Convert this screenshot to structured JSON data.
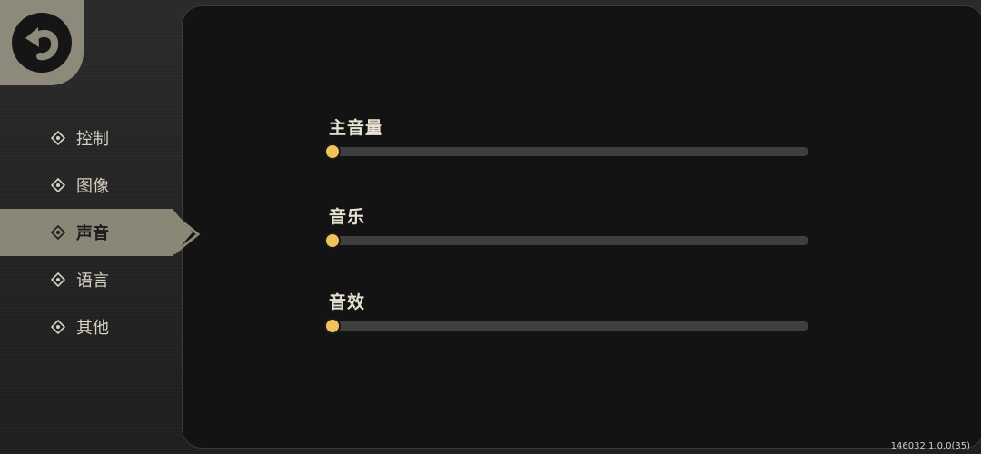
{
  "sidebar": {
    "items": [
      {
        "label": "控制",
        "active": false
      },
      {
        "label": "图像",
        "active": false
      },
      {
        "label": "声音",
        "active": true
      },
      {
        "label": "语言",
        "active": false
      },
      {
        "label": "其他",
        "active": false
      }
    ]
  },
  "settings": [
    {
      "label": "主音量",
      "value": 0
    },
    {
      "label": "音乐",
      "value": 0
    },
    {
      "label": "音效",
      "value": 0
    }
  ],
  "footer": {
    "version": "146032 1.0.0(35)"
  },
  "colors": {
    "accent": "#e8b640",
    "active_tab": "#8a8777",
    "panel": "#131313"
  },
  "icons": {
    "back": "back-arrow-icon",
    "menu_bullet": "diamond-icon"
  }
}
